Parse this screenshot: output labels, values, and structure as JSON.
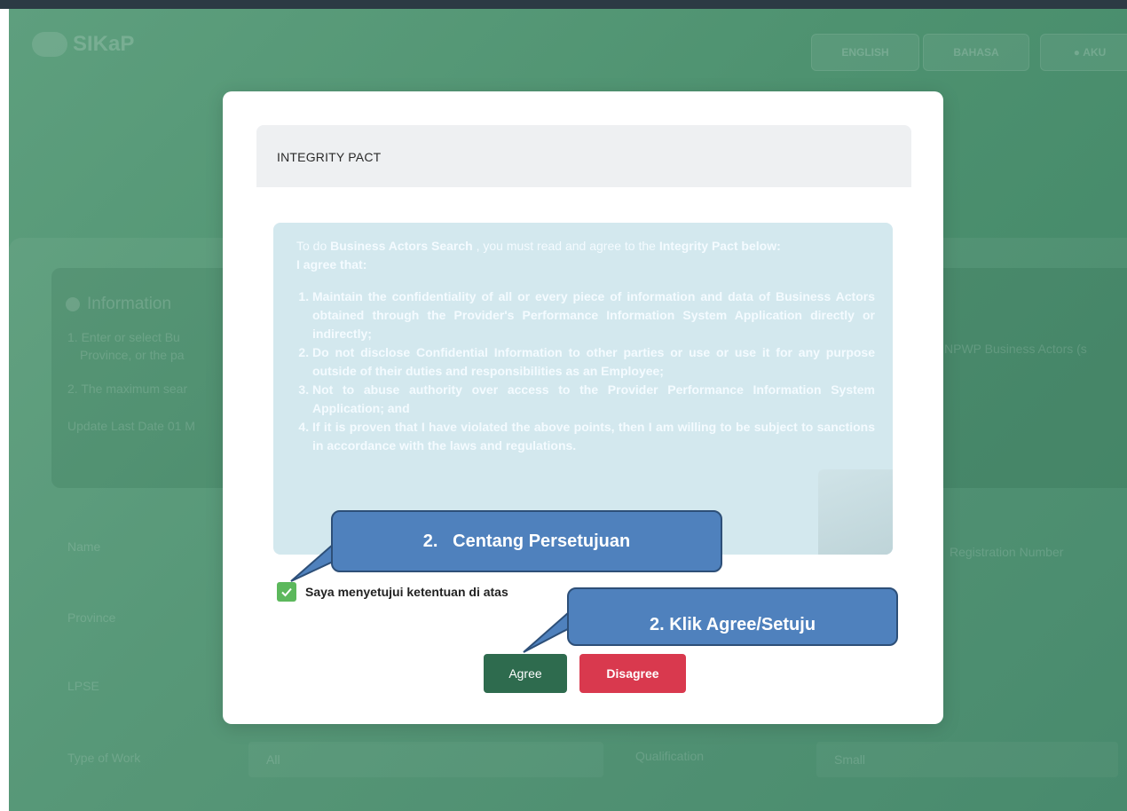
{
  "background": {
    "brand": "SIKaP",
    "nav": {
      "english": "ENGLISH",
      "bahasa": "BAHASA",
      "account": "AKU"
    },
    "info_title": "Information",
    "info_lines": [
      "1. Enter or select Bu",
      "Province, or the pa",
      "2. The maximum sear"
    ],
    "info_right": "NPWP Business Actors (s",
    "update": "Update Last Date 01 M",
    "form": {
      "name_label": "Name",
      "province_label": "Province",
      "lpse_label": "LPSE",
      "type_label": "Type of Work",
      "type_value": "All",
      "qualification_label": "Qualification",
      "qualification_value": "Small",
      "right_label": "Registration Number"
    }
  },
  "modal": {
    "title": "INTEGRITY PACT",
    "intro": {
      "p1": "To do ",
      "b1": "Business Actors Search",
      "p2": " , you must read and agree to the ",
      "b2": "Integrity Pact below:",
      "agree_heading": "I agree that:"
    },
    "items": [
      "Maintain the confidentiality of all or every piece of information and data of Business Actors obtained through the Provider's Performance Information System Application directly or indirectly;",
      "Do not disclose Confidential Information to other parties or use or use it for any purpose outside of their duties and responsibilities as an Employee;",
      "Not to abuse authority over access to the Provider Performance Information System Application; and",
      "If it is proven that I have violated the above points, then I am willing to be subject to sanctions in accordance with the laws and regulations."
    ],
    "checkbox_label": "Saya menyetujui ketentuan di atas",
    "checkbox_checked": true,
    "agree_button": "Agree",
    "disagree_button": "Disagree"
  },
  "callouts": {
    "check": "2.   Centang Persetujuan",
    "agree": "2. Klik Agree/Setuju"
  },
  "colors": {
    "callout": "#4f81bd",
    "agree_button": "#2e6b4e",
    "disagree_button": "#d9394e",
    "checkbox": "#5cb85c"
  }
}
